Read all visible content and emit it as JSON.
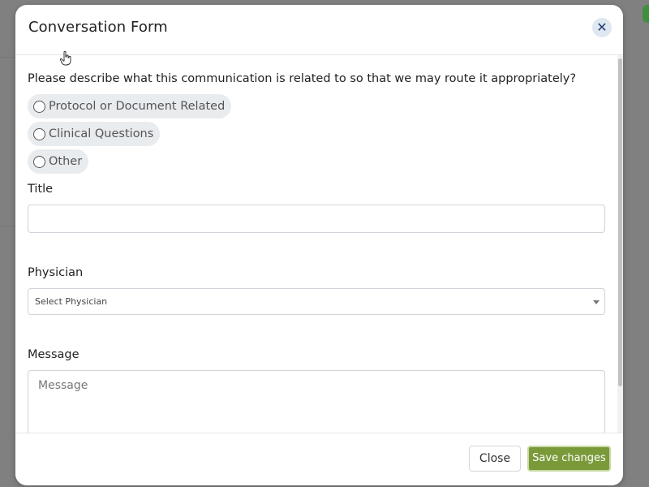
{
  "modal": {
    "title": "Conversation Form",
    "close_icon": "close-icon"
  },
  "form": {
    "question": "Please describe what this communication is related to so that we may route it appropriately?",
    "options": [
      {
        "label": "Protocol or Document Related",
        "selected": false
      },
      {
        "label": "Clinical Questions",
        "selected": false
      },
      {
        "label": "Other",
        "selected": false
      }
    ],
    "title_label": "Title",
    "title_value": "",
    "physician_label": "Physician",
    "physician_selected": "Select Physician",
    "message_label": "Message",
    "message_placeholder": "Message"
  },
  "footer": {
    "close_label": "Close",
    "save_label": "Save changes"
  },
  "colors": {
    "save_button": "#7a9a3a",
    "close_icon_bg": "#dfe7f1",
    "close_icon_fg": "#1f3f73",
    "backdrop": "#808080"
  }
}
